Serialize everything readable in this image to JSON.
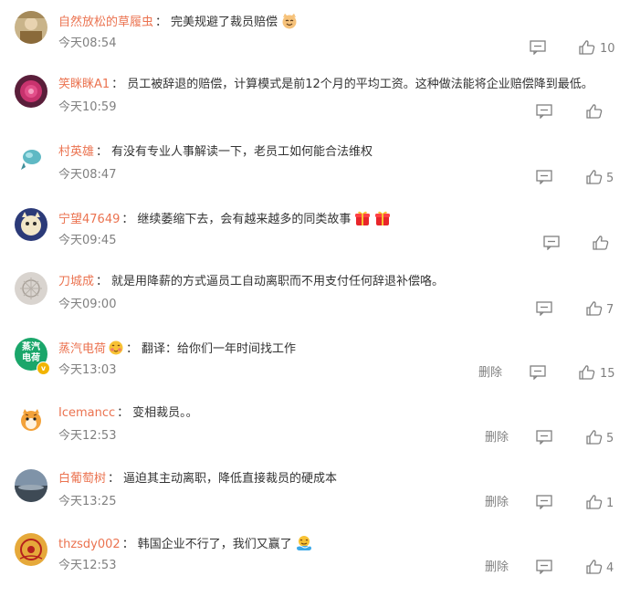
{
  "comments": [
    {
      "user": "自然放松的草履虫",
      "text": "完美规避了裁员赔偿",
      "time": "今天08:54",
      "likes": "10"
    },
    {
      "user": "笑眯眯A1",
      "text": "员工被辞退的赔偿，计算模式是前12个月的平均工资。这种做法能将企业赔偿降到最低。",
      "time": "今天10:59",
      "likes": ""
    },
    {
      "user": "村英雄",
      "text": "有没有专业人事解读一下，老员工如何能合法维权",
      "time": "今天08:47",
      "likes": "5"
    },
    {
      "user": "宁望47649",
      "text": "继续萎缩下去，会有越来越多的同类故事",
      "time": "今天09:45",
      "likes": ""
    },
    {
      "user": "刀城成",
      "text": "就是用降薪的方式逼员工自动离职而不用支付任何辞退补偿咯。",
      "time": "今天09:00",
      "likes": "7"
    },
    {
      "user": "蒸汽电荷",
      "text": "翻译：给你们一年时间找工作",
      "time": "今天13:03",
      "likes": "15",
      "delete": "删除",
      "avatar_text": [
        "蒸汽",
        "电荷"
      ]
    },
    {
      "user": "Icemancc",
      "text": "变相裁员。。",
      "time": "今天12:53",
      "likes": "5",
      "delete": "删除"
    },
    {
      "user": "白葡萄树",
      "text": "逼迫其主动离职，降低直接裁员的硬成本",
      "time": "今天13:25",
      "likes": "1",
      "delete": "删除"
    },
    {
      "user": "thzsdy002",
      "text": "韩国企业不行了，我们又赢了",
      "time": "今天12:53",
      "likes": "4",
      "delete": "删除"
    }
  ],
  "colors": {
    "username": "#eb7350",
    "text": "#333333",
    "meta": "#808080"
  }
}
